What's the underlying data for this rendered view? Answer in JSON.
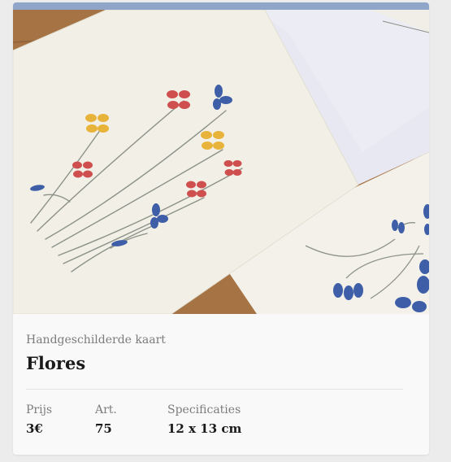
{
  "product": {
    "subtitle": "Handgeschilderde kaart",
    "title": "Flores"
  },
  "specs": [
    {
      "label": "Prijs",
      "value": "3€"
    },
    {
      "label": "Art.",
      "value": "75"
    },
    {
      "label": "Specificaties",
      "value": "12 x 13 cm"
    }
  ],
  "colors": {
    "accent_bar": "#8fa6c9",
    "card_background": "#ffffff",
    "info_background": "#f9f9f9",
    "page_background": "#ececec"
  }
}
